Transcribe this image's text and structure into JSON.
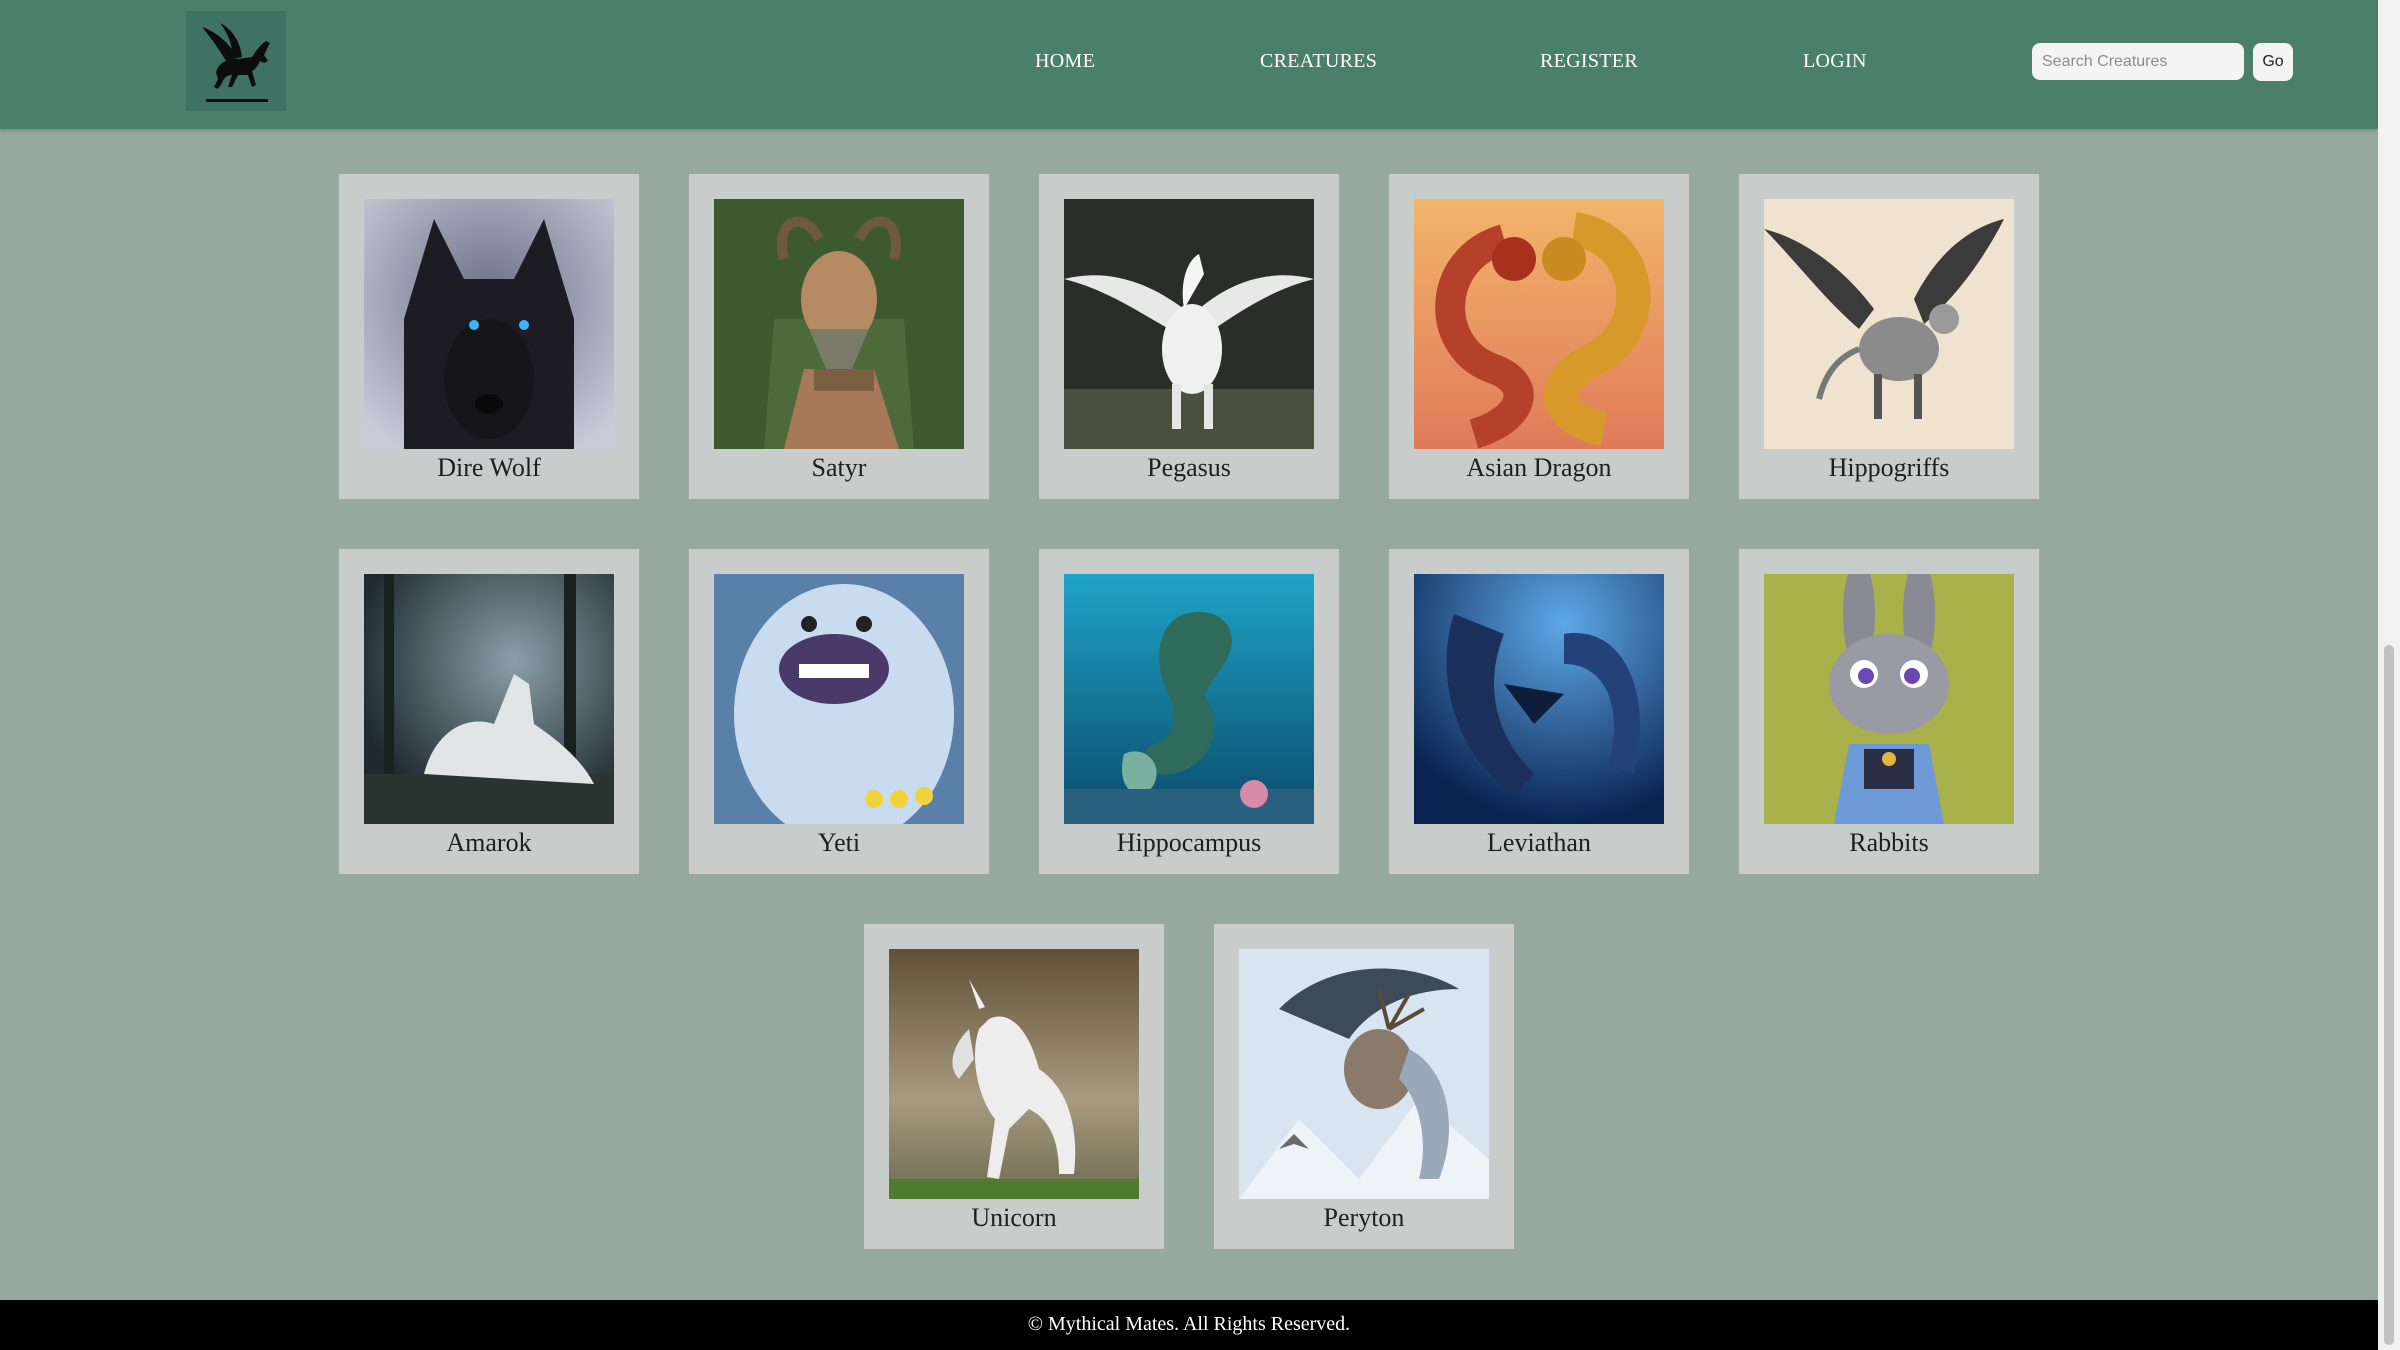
{
  "nav": {
    "logo_alt": "Mythical Mates pegasus logo",
    "links": [
      "HOME",
      "CREATURES",
      "REGISTER",
      "LOGIN"
    ],
    "search_placeholder": "Search Creatures",
    "search_value": "",
    "go_label": "Go"
  },
  "creatures": [
    {
      "name": "Dire Wolf"
    },
    {
      "name": "Satyr"
    },
    {
      "name": "Pegasus"
    },
    {
      "name": "Asian Dragon"
    },
    {
      "name": "Hippogriffs"
    },
    {
      "name": "Amarok"
    },
    {
      "name": "Yeti"
    },
    {
      "name": "Hippocampus"
    },
    {
      "name": "Leviathan"
    },
    {
      "name": "Rabbits"
    },
    {
      "name": "Unicorn"
    },
    {
      "name": "Peryton"
    }
  ],
  "footer": {
    "text": "© Mythical Mates. All Rights Reserved."
  },
  "colors": {
    "header_bg": "#4a7f6c",
    "page_bg": "#97a8a0",
    "card_bg": "#c8cccb",
    "footer_bg": "#000000"
  }
}
